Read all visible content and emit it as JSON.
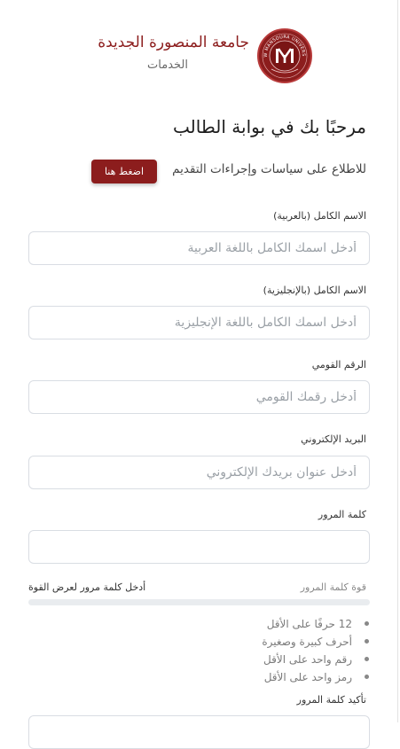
{
  "header": {
    "university_name": "جامعة المنصورة الجديدة",
    "subtitle": "الخدمات",
    "logo_text": "NEW MANSOURA UNIVERSITY"
  },
  "welcome": {
    "title": "مرحبًا بك في بوابة الطالب",
    "policy_text": "للاطلاع على سياسات وإجراءات التقديم",
    "policy_button": "اضغط هنا"
  },
  "form": {
    "fields": [
      {
        "label": "الاسم الكامل (بالعربية)",
        "placeholder": "أدخل اسمك الكامل باللغة العربية",
        "value": ""
      },
      {
        "label": "الاسم الكامل (بالإنجليزية)",
        "placeholder": "أدخل اسمك الكامل باللغة الإنجليزية",
        "value": ""
      },
      {
        "label": "الرقم القومي",
        "placeholder": "أدخل رقمك القومي",
        "value": ""
      },
      {
        "label": "البريد الإلكتروني",
        "placeholder": "أدخل عنوان بريدك الإلكتروني",
        "value": ""
      },
      {
        "label": "كلمة المرور",
        "placeholder": "",
        "value": ""
      },
      {
        "label": "تأكيد كلمة المرور",
        "placeholder": "",
        "value": ""
      }
    ],
    "strength": {
      "label": "قوة كلمة المرور",
      "text": "أدخل كلمة مرور لعرض القوة",
      "level": 0
    },
    "rules": [
      "12 حرفًا على الأقل",
      "أحرف كبيرة وصغيرة",
      "رقم واحد على الأقل",
      "رمز واحد على الأقل"
    ]
  },
  "colors": {
    "brand": "#8c1d1d",
    "input_border": "#d9dde3",
    "strength_track": "#e9ecef"
  }
}
